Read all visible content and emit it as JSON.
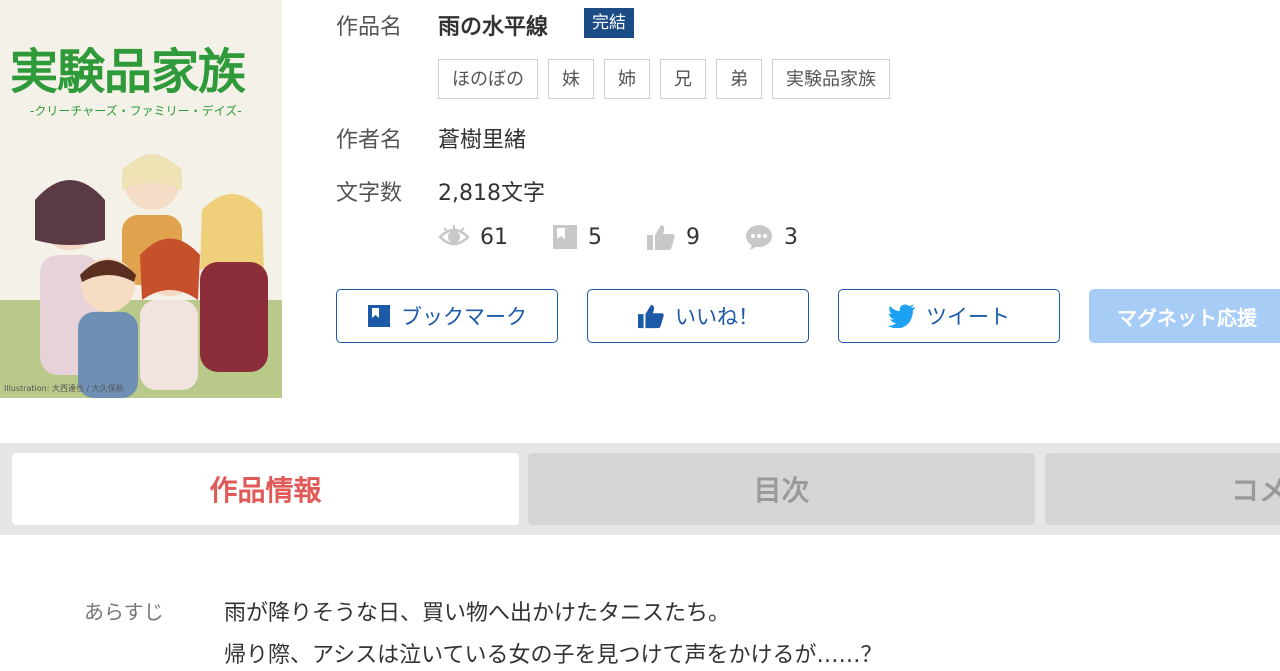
{
  "cover": {
    "title": "実験品家族",
    "subtitle": "-クリーチャーズ・ファミリー・デイズ-",
    "credit": "Illustration: 大西達也 / 大久保新"
  },
  "info": {
    "title_label": "作品名",
    "title": "雨の水平線",
    "status_badge": "完結",
    "tags": [
      "ほのぼの",
      "妹",
      "姉",
      "兄",
      "弟",
      "実験品家族"
    ],
    "author_label": "作者名",
    "author": "蒼樹里緒",
    "chars_label": "文字数",
    "chars": "2,818文字",
    "stats": {
      "views": "61",
      "bookmarks": "5",
      "likes": "9",
      "comments": "3"
    }
  },
  "actions": {
    "bookmark": "ブックマーク",
    "like": "いいね！",
    "tweet": "ツイート",
    "magnet": "マグネット応援"
  },
  "tabs": [
    "作品情報",
    "目次",
    "コメント"
  ],
  "synopsis": {
    "label": "あらすじ",
    "lines": [
      "雨が降りそうな日、買い物へ出かけたタニスたち。",
      "帰り際、アシスは泣いている女の子を見つけて声をかけるが……？"
    ]
  },
  "colors": {
    "accent": "#1c5aa8",
    "badge": "#1c4c86",
    "tab_active_text": "#e05a57",
    "magnet": "#a7ccf5"
  },
  "icons": [
    "eye-icon",
    "bookmark-icon",
    "thumbs-up-icon",
    "comment-icon",
    "twitter-icon"
  ]
}
